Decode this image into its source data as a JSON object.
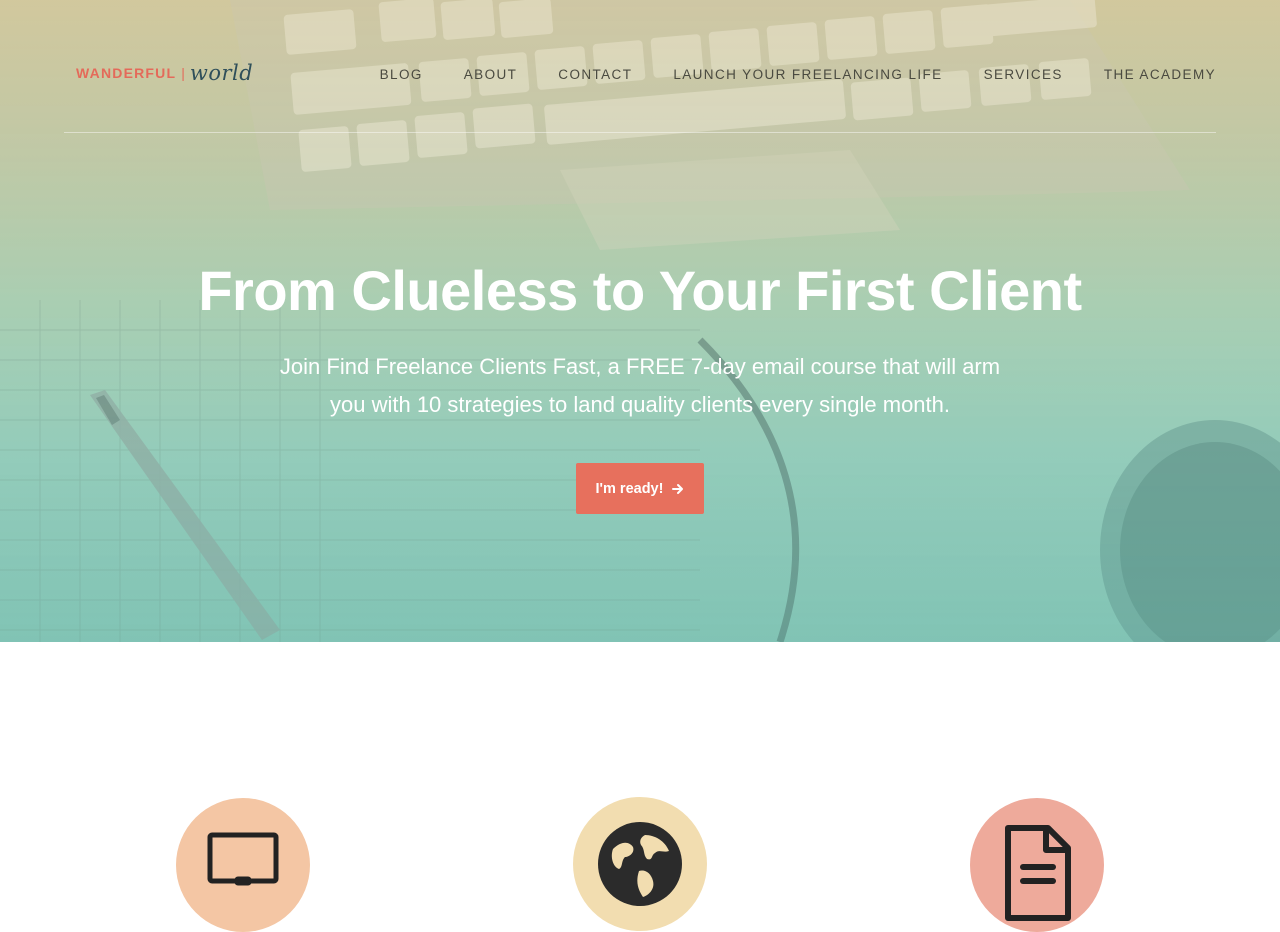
{
  "header": {
    "logo": {
      "brand_left": "WANDERFUL",
      "separator": "|",
      "brand_right": "world"
    },
    "nav": [
      {
        "label": "BLOG"
      },
      {
        "label": "ABOUT"
      },
      {
        "label": "CONTACT"
      },
      {
        "label": "LAUNCH YOUR FREELANCING LIFE"
      },
      {
        "label": "SERVICES"
      },
      {
        "label": "THE ACADEMY"
      }
    ]
  },
  "hero": {
    "title": "From Clueless to Your First Client",
    "subtitle": "Join Find Freelance Clients Fast, a FREE 7-day email course that will arm you with 10 strategies to land quality clients every single month.",
    "cta_label": "I'm ready!",
    "cta_icon": "arrow-right-icon"
  },
  "features": [
    {
      "icon": "laptop-icon",
      "color": "#f4c6a4"
    },
    {
      "icon": "globe-icon",
      "color": "#f2ddb0"
    },
    {
      "icon": "document-icon",
      "color": "#eeaa9b"
    }
  ],
  "colors": {
    "brand_coral": "#e46a5a",
    "brand_dark": "#2f4f5a",
    "cta": "#e7705d",
    "nav_text": "#4a4a40",
    "hero_text": "#ffffff"
  }
}
